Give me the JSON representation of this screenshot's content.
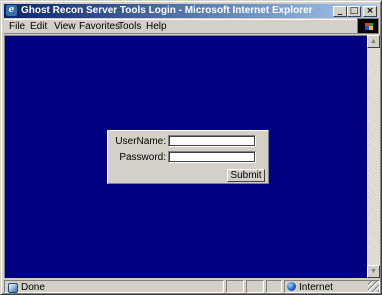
{
  "window": {
    "title": "Ghost Recon Server Tools Login - Microsoft Internet Explorer",
    "buttons": {
      "minimize": "_",
      "maximize": "□",
      "close": "×"
    }
  },
  "menu": {
    "items": [
      {
        "label": "File"
      },
      {
        "label": "Edit"
      },
      {
        "label": "View"
      },
      {
        "label": "Favorites"
      },
      {
        "label": "Tools"
      },
      {
        "label": "Help"
      }
    ]
  },
  "page": {
    "background": "#000080"
  },
  "login": {
    "username_label": "UserName:",
    "username_value": "",
    "password_label": "Password:",
    "password_value": "",
    "submit_label": "Submit"
  },
  "scrollbar": {
    "up": "▲",
    "down": "▼"
  },
  "status": {
    "text": "Done",
    "zone": "Internet"
  }
}
